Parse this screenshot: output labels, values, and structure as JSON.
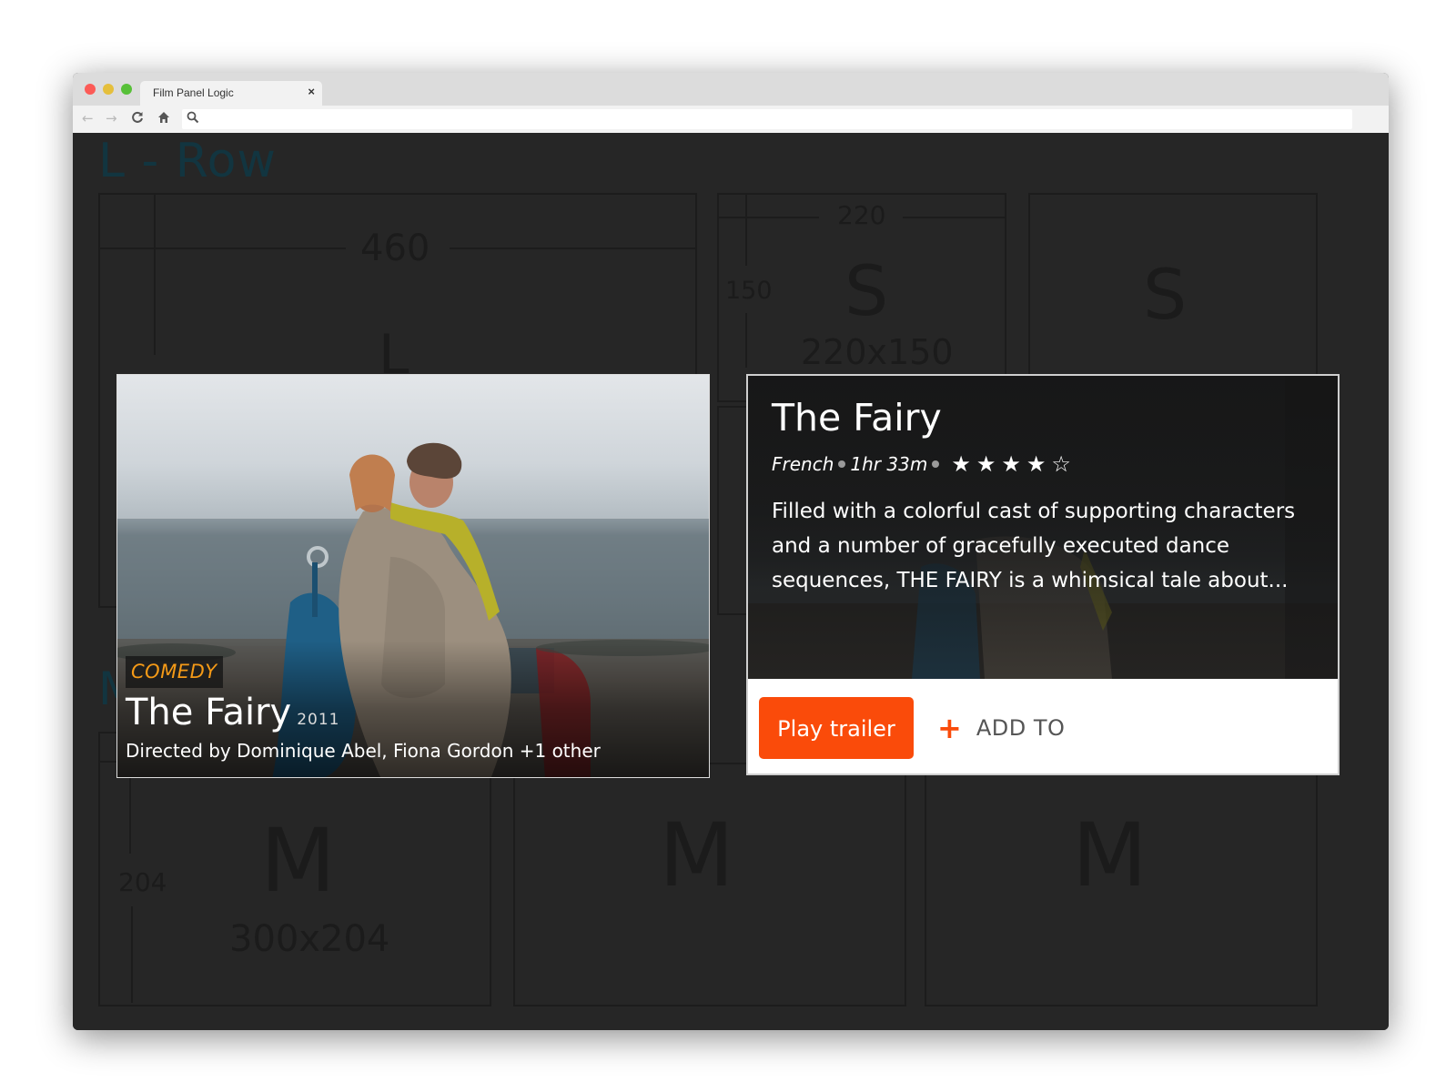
{
  "browser": {
    "tab_title": "Film Panel Logic",
    "tab_close": "×",
    "back_icon": "←",
    "forward_icon": "→",
    "reload_icon": "C",
    "home_icon": "⌂",
    "search_icon": "⚲"
  },
  "wireframe": {
    "heading": "L - Row",
    "l_width": "460",
    "l_letter": "L",
    "s1_width": "220",
    "s1_height": "150",
    "s1_letter": "S",
    "s1_size": "220x150",
    "s2_letter": "S",
    "m_row_letter": "M",
    "m_width_partial": "300",
    "m1_height": "204",
    "m1_letter": "M",
    "m1_size": "300x204",
    "m2_letter": "M",
    "m3_letter": "M"
  },
  "film_card": {
    "genre": "COMEDY",
    "title": "The Fairy",
    "year": "2011",
    "directors": "Directed by Dominique Abel, Fiona Gordon +1 other"
  },
  "detail_panel": {
    "title": "The Fairy",
    "language": "French",
    "runtime": "1hr 33m",
    "rating": 4,
    "rating_max": 5,
    "star_full": "★",
    "star_empty": "☆",
    "description": "Filled with a colorful cast of supporting characters and a number of gracefully executed dance sequences, THE FAIRY is a whimsical tale about...",
    "play_label": "Play trailer",
    "add_icon": "+",
    "add_label": "ADD TO"
  },
  "colors": {
    "accent": "#fa4b0a",
    "genre": "#f59a17",
    "page_bg": "#262626"
  }
}
